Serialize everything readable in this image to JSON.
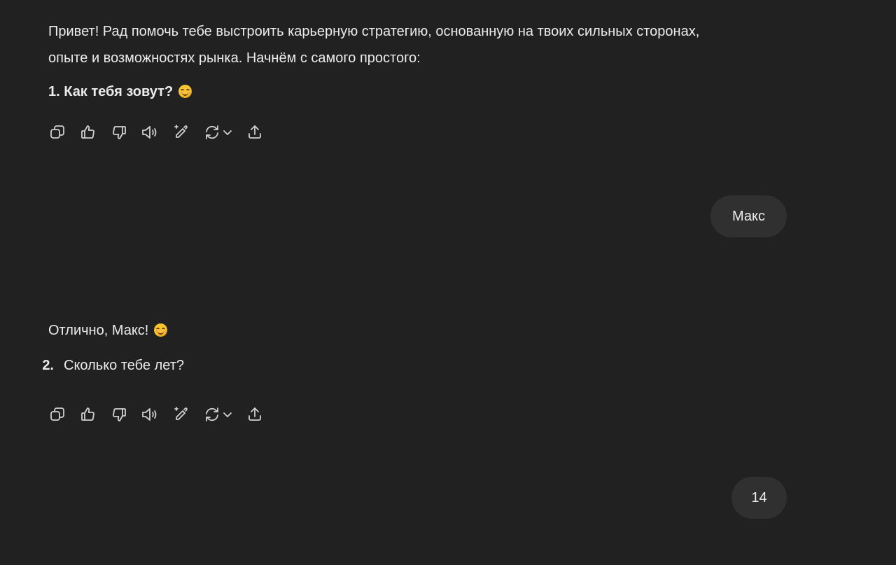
{
  "conversation": {
    "assistant_1": {
      "line_1": "Привет! Рад помочь тебе выстроить карьерную стратегию, основанную на твоих сильных сторонах,",
      "line_2": "опыте и возможностях рынка. Начнём с самого простого:",
      "question": "1. Как тебя зовут?",
      "emoji": "smiling-face-with-smiling-eyes"
    },
    "user_1": {
      "text": "Макс"
    },
    "assistant_2": {
      "intro": "Отлично, Макс!",
      "emoji": "smiling-face-with-smiling-eyes",
      "list_number": "2.",
      "question": "Сколько тебе лет?"
    },
    "user_2": {
      "text": "14"
    }
  },
  "message_actions": [
    {
      "icon": "copy-icon"
    },
    {
      "icon": "thumbs-up-icon"
    },
    {
      "icon": "thumbs-down-icon"
    },
    {
      "icon": "read-aloud-icon"
    },
    {
      "icon": "edit-sparkle-icon"
    },
    {
      "icon": "regenerate-icon"
    },
    {
      "icon": "share-icon"
    }
  ],
  "colors": {
    "background": "#212121",
    "text": "#ececec",
    "user_bubble": "#303030",
    "icon": "#d0d0d0"
  }
}
